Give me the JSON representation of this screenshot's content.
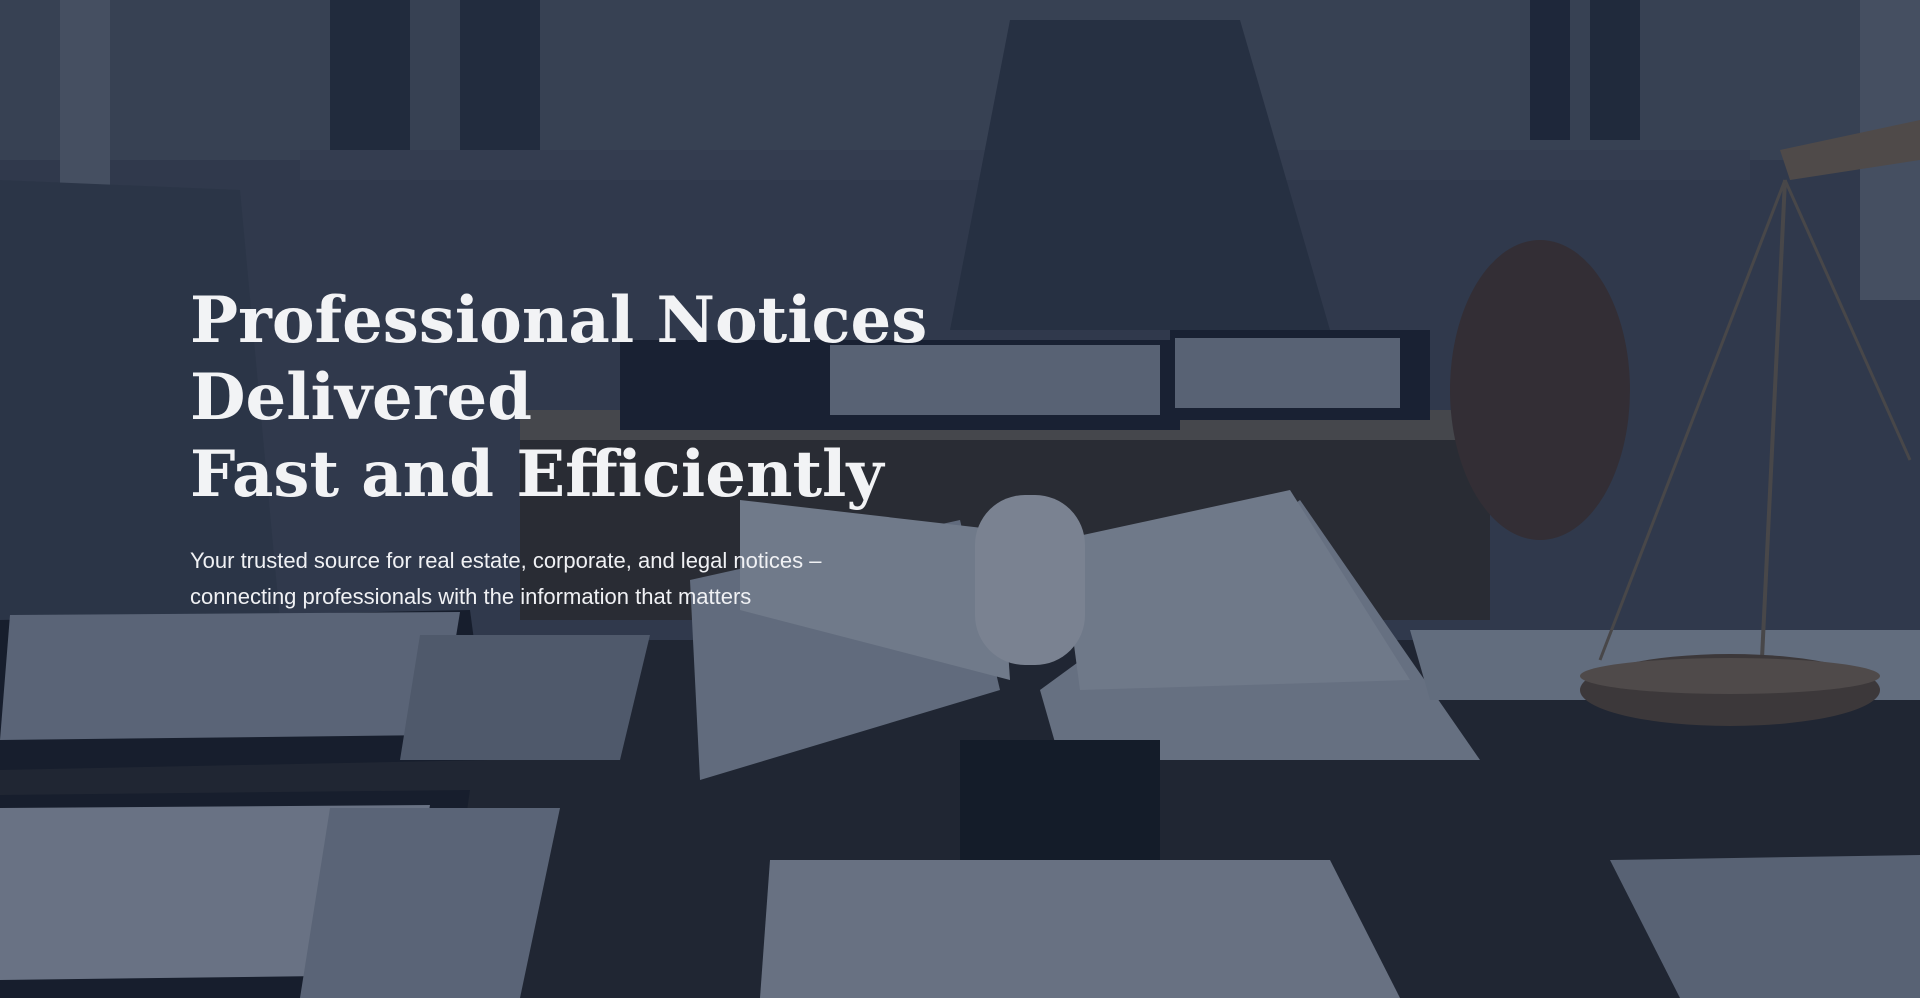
{
  "hero": {
    "title_line1": "Professional Notices Delivered",
    "title_line2": "Fast and Efficiently",
    "subtitle_line1": "Your trusted source for real estate, corporate, and legal notices –",
    "subtitle_line2": "connecting professionals with the information that matters"
  },
  "colors": {
    "overlay": "#142034",
    "title_text": "#f2f3f5",
    "subtitle_text": "#f0f1f4"
  }
}
